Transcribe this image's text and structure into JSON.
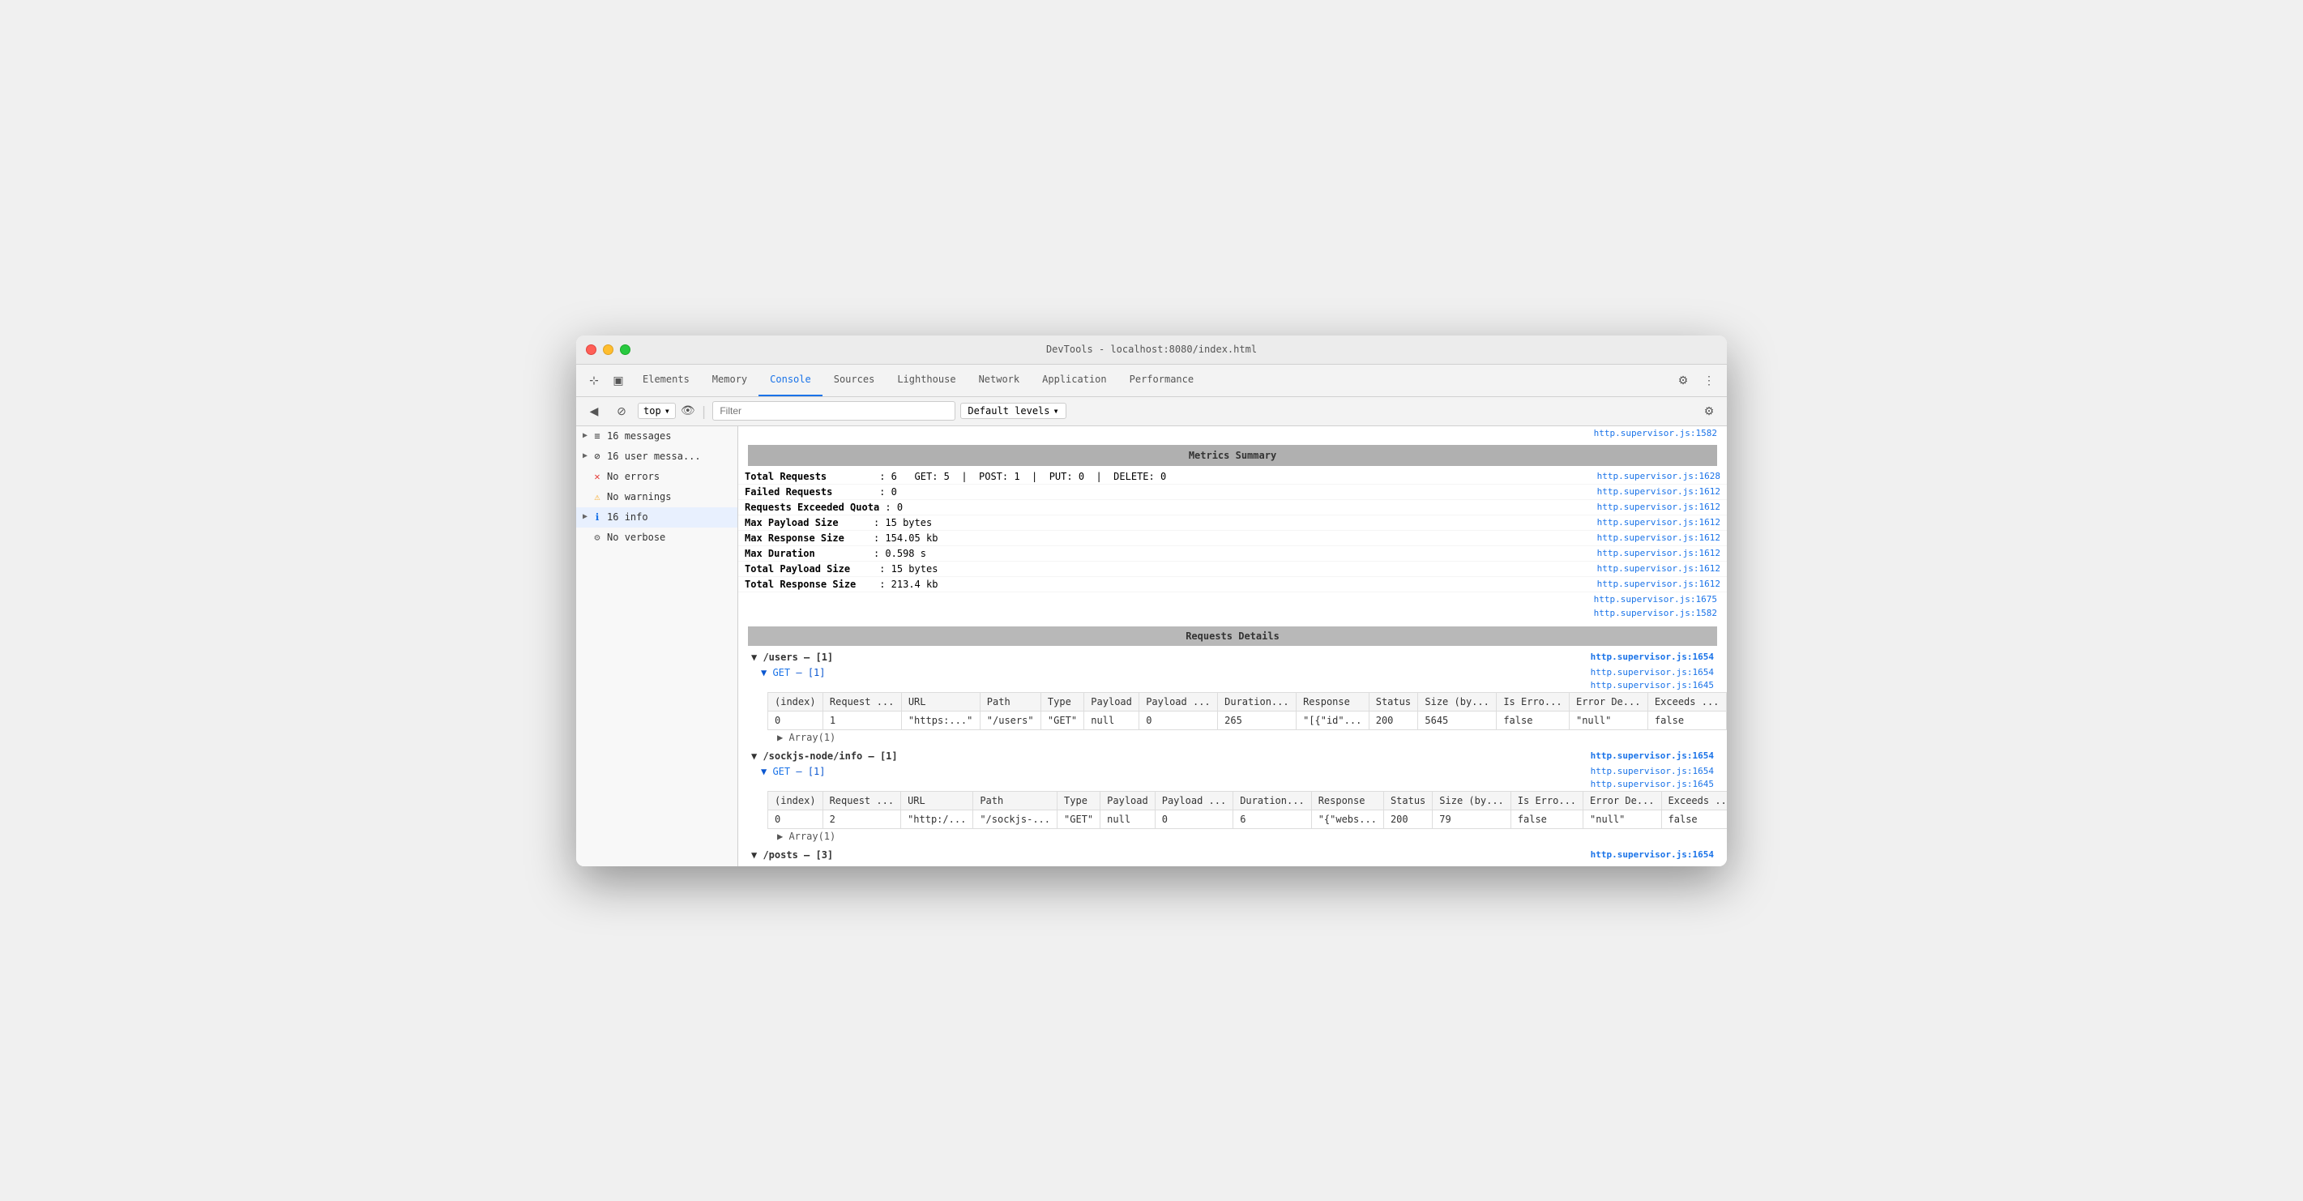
{
  "window": {
    "title": "DevTools - localhost:8080/index.html"
  },
  "tabs": [
    {
      "label": "Elements",
      "active": false
    },
    {
      "label": "Memory",
      "active": false
    },
    {
      "label": "Console",
      "active": true
    },
    {
      "label": "Sources",
      "active": false
    },
    {
      "label": "Lighthouse",
      "active": false
    },
    {
      "label": "Network",
      "active": false
    },
    {
      "label": "Application",
      "active": false
    },
    {
      "label": "Performance",
      "active": false
    }
  ],
  "second_toolbar": {
    "context": "top",
    "filter_placeholder": "Filter",
    "level": "Default levels"
  },
  "sidebar": {
    "items": [
      {
        "icon": "≡",
        "label": "16 messages",
        "type": "list",
        "expandable": true
      },
      {
        "icon": "⊘",
        "label": "16 user messa...",
        "type": "user",
        "expandable": true
      },
      {
        "icon": "✕",
        "label": "No errors",
        "type": "error"
      },
      {
        "icon": "⚠",
        "label": "No warnings",
        "type": "warning"
      },
      {
        "icon": "ℹ",
        "label": "16 info",
        "type": "info",
        "expandable": true,
        "selected": true
      },
      {
        "icon": "⚙",
        "label": "No verbose",
        "type": "verbose"
      }
    ]
  },
  "metrics_summary": {
    "header": "Metrics Summary",
    "rows": [
      {
        "label": "Total Requests",
        "value": ": 6  GET: 5  |  POST: 1  |  PUT: 0  |  DELETE: 0"
      },
      {
        "label": "Failed Requests",
        "value": ": 0"
      },
      {
        "label": "Requests Exceeded Quota",
        "value": ": 0"
      },
      {
        "label": "Max Payload Size",
        "value": ": 15 bytes"
      },
      {
        "label": "Max Response Size",
        "value": ": 154.05 kb"
      },
      {
        "label": "Max Duration",
        "value": ": 0.598 s"
      },
      {
        "label": "Total Payload Size",
        "value": ": 15 bytes"
      },
      {
        "label": "Total Response Size",
        "value": ": 213.4 kb"
      }
    ]
  },
  "requests_details": {
    "header": "Requests Details",
    "groups": [
      {
        "path": "/users",
        "count": "[1]",
        "subgroups": [
          {
            "method": "GET",
            "count": "[1]",
            "columns": [
              "(index)",
              "Request ...",
              "URL",
              "Path",
              "Type",
              "Payload",
              "Payload ...",
              "Duration...",
              "Response",
              "Status",
              "Size (by...",
              "Is Erro...",
              "Error De...",
              "Exceeds ..."
            ],
            "rows": [
              [
                "0",
                "1",
                "\"https:...",
                "\"/users\"",
                "\"GET\"",
                "null",
                "0",
                "265",
                "\"[{\"id\"...",
                "200",
                "5645",
                "false",
                "\"null\"",
                "false"
              ]
            ],
            "array_expand": "▶ Array(1)"
          }
        ]
      },
      {
        "path": "/sockjs-node/info",
        "count": "[1]",
        "subgroups": [
          {
            "method": "GET",
            "count": "[1]",
            "columns": [
              "(index)",
              "Request ...",
              "URL",
              "Path",
              "Type",
              "Payload",
              "Payload ...",
              "Duration...",
              "Response",
              "Status",
              "Size (by...",
              "Is Erro...",
              "Error De...",
              "Exceeds ..."
            ],
            "rows": [
              [
                "0",
                "2",
                "\"http:/...",
                "\"/sockjs-...",
                "\"GET\"",
                "null",
                "0",
                "6",
                "\"{\"webs...",
                "200",
                "79",
                "false",
                "\"null\"",
                "false"
              ]
            ],
            "array_expand": "▶ Array(1)"
          }
        ]
      },
      {
        "path": "/posts",
        "count": "[3]",
        "subgroups": []
      }
    ]
  },
  "file_links": {
    "supervisor_1582": "http.supervisor.js:1582",
    "supervisor_1628": "http.supervisor.js:1628",
    "supervisor_1612": "http.supervisor.js:1612",
    "supervisor_1675": "http.supervisor.js:1675",
    "supervisor_1654": "http.supervisor.js:1654",
    "supervisor_1645": "http.supervisor.js:1645"
  },
  "colors": {
    "active_tab": "#1a73e8",
    "link": "#1a73e8",
    "red": "#c62828",
    "green": "#2e7d32"
  }
}
